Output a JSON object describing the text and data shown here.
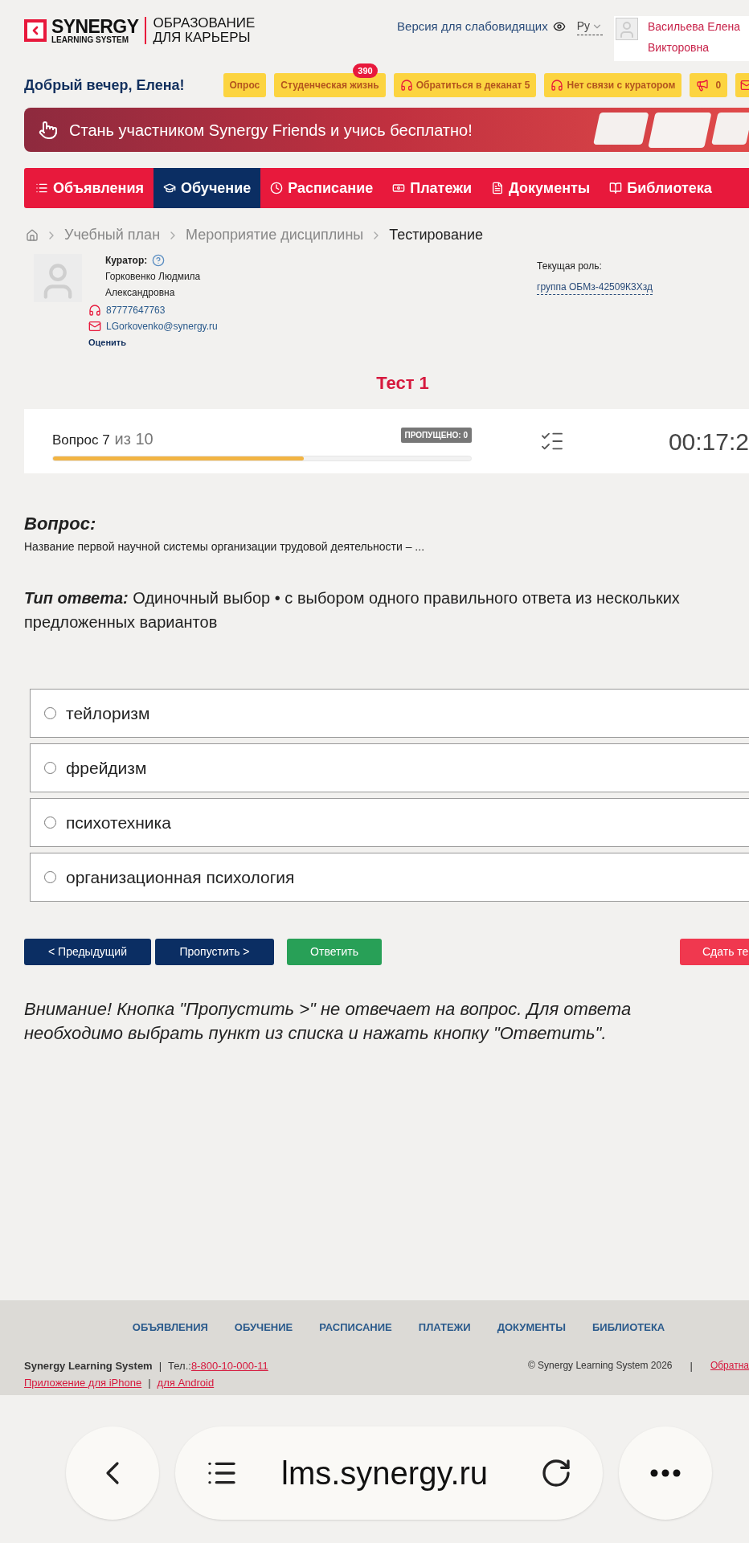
{
  "header": {
    "logo": {
      "brand": "SYNERGY",
      "sub": "LEARNING SYSTEM",
      "tagline": [
        "ОБРАЗОВАНИЕ",
        "ДЛЯ КАРЬЕРЫ"
      ]
    },
    "accessibility_link": "Версия для слабовидящих",
    "language": "Ру",
    "user_name": "Васильева Елена Викторовна"
  },
  "greeting": "Добрый вечер, Елена!",
  "quick_buttons": [
    {
      "kind": "plain",
      "label": "Опрос"
    },
    {
      "kind": "badge",
      "label": "Студенческая жизнь",
      "badge": "390"
    },
    {
      "kind": "headset",
      "label": "Обратиться в деканат 5"
    },
    {
      "kind": "headset",
      "label": "Нет связи с куратором"
    },
    {
      "kind": "megaphone",
      "label": "0"
    },
    {
      "kind": "mail"
    }
  ],
  "banner": {
    "text": "Стань участником Synergy Friends и учись бесплатно!"
  },
  "nav": [
    {
      "label": "Объявления",
      "selected": false
    },
    {
      "label": "Обучение",
      "selected": true
    },
    {
      "label": "Расписание",
      "selected": false
    },
    {
      "label": "Платежи",
      "selected": false
    },
    {
      "label": "Документы",
      "selected": false
    },
    {
      "label": "Библиотека",
      "selected": false
    }
  ],
  "breadcrumb": [
    {
      "label": "Учебный план",
      "current": false
    },
    {
      "label": "Мероприятие дисциплины",
      "current": false
    },
    {
      "label": "Тестирование",
      "current": true
    }
  ],
  "curator": {
    "label": "Куратор:",
    "name": "Горковенко Людмила Александровна",
    "phone": "87777647763",
    "email": "LGorkovenko@synergy.ru",
    "rate": "Оценить"
  },
  "role": {
    "label": "Текущая роль:",
    "value": "группа ОБМз-42509К3Хзд"
  },
  "test_title": "Тест 1",
  "progress": {
    "question": "Вопрос 7",
    "total": "из 10",
    "skipped": "ПРОПУЩЕНО: 0",
    "level": 0.6,
    "timer": "00:17:2"
  },
  "question": {
    "heading": "Вопрос:",
    "text": "Название первой научной системы организации трудовой деятельности – ..."
  },
  "answer_type": {
    "label": "Тип ответа:",
    "value": "Одиночный выбор • с выбором одного правильного ответа из нескольких предложенных вариантов"
  },
  "options": [
    {
      "label": "тейлоризм",
      "selected": false
    },
    {
      "label": "фрейдизм",
      "selected": false
    },
    {
      "label": "психотехника",
      "selected": false
    },
    {
      "label": "организационная психология",
      "selected": false
    }
  ],
  "buttons": [
    {
      "kind": "prev",
      "label": "< Предыдущий"
    },
    {
      "kind": "skip",
      "label": "Пропустить >"
    },
    {
      "kind": "answer",
      "label": "Ответить"
    },
    {
      "kind": "submit",
      "label": "Сдать те"
    }
  ],
  "warning": "Внимание! Кнопка \"Пропустить >\" не отвечает на вопрос. Для ответа необходимо выбрать пункт из списка и нажать кнопку \"Ответить\".",
  "footer": {
    "links": [
      "ОБЪЯВЛЕНИЯ",
      "ОБУЧЕНИЕ",
      "РАСПИСАНИЕ",
      "ПЛАТЕЖИ",
      "ДОКУМЕНТЫ",
      "БИБЛИОТЕКА"
    ],
    "company": "Synergy Learning System",
    "separators": [
      "|",
      "|",
      "|"
    ],
    "phone_label": "Тел.:",
    "phone": "8-800-10-000-11",
    "apps": [
      "Приложение для iPhone",
      "для Android"
    ],
    "copyright": "© Synergy Learning System 2026",
    "feedback": "Обратна"
  },
  "browser": {
    "url": "lms.synergy.ru"
  }
}
